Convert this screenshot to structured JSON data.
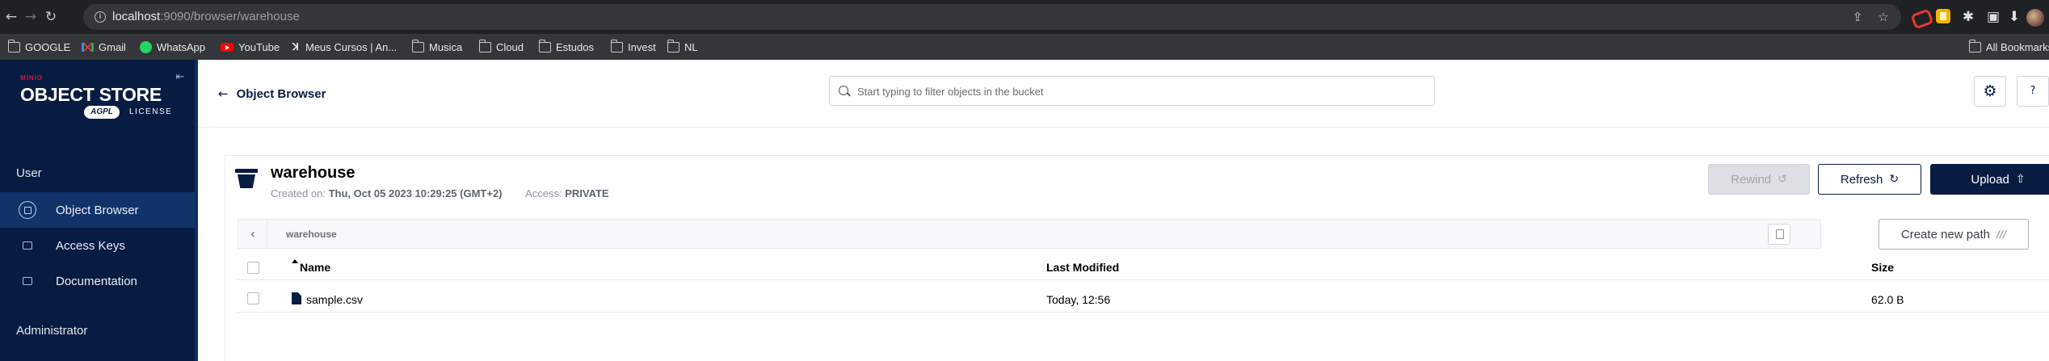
{
  "browser": {
    "url_host": "localhost",
    "url_rest": ":9090/browser/warehouse",
    "nav": {
      "back": "←",
      "forward": "→",
      "reload": "↻"
    },
    "bookmarks": [
      {
        "label": "GOOGLE",
        "icon": "folder-icon"
      },
      {
        "label": "Gmail",
        "icon": "gmail-icon"
      },
      {
        "label": "WhatsApp",
        "icon": "whatsapp-icon"
      },
      {
        "label": "YouTube",
        "icon": "youtube-icon"
      },
      {
        "label": "Meus Cursos | An...",
        "icon": "site-icon"
      },
      {
        "label": "Musica",
        "icon": "folder-icon"
      },
      {
        "label": "Cloud",
        "icon": "folder-icon"
      },
      {
        "label": "Estudos",
        "icon": "folder-icon"
      },
      {
        "label": "Invest",
        "icon": "folder-icon"
      },
      {
        "label": "NL",
        "icon": "folder-icon"
      }
    ],
    "all_bookmarks": "All Bookmarks"
  },
  "sidebar": {
    "logo_brand": "MINIO",
    "logo_title": "OBJECT STORE",
    "logo_badge": "AGPL",
    "logo_license": "LICENSE",
    "section_user": "User",
    "items": [
      {
        "label": "Object Browser",
        "active": true
      },
      {
        "label": "Access Keys",
        "active": false
      },
      {
        "label": "Documentation",
        "active": false
      }
    ],
    "section_admin": "Administrator"
  },
  "topbar": {
    "back_label": "Object Browser",
    "search_placeholder": "Start typing to filter objects in the bucket"
  },
  "bucket": {
    "name": "warehouse",
    "created_label": "Created on:",
    "created_value": "Thu, Oct 05 2023 10:29:25 (GMT+2)",
    "access_label": "Access:",
    "access_value": "PRIVATE",
    "buttons": {
      "rewind": "Rewind",
      "refresh": "Refresh",
      "upload": "Upload"
    },
    "path": "warehouse",
    "create_path": "Create new path"
  },
  "table": {
    "headers": {
      "name": "Name",
      "last_modified": "Last Modified",
      "size": "Size"
    },
    "rows": [
      {
        "name": "sample.csv",
        "last_modified": "Today, 12:56",
        "size": "62.0 B"
      }
    ]
  },
  "colors": {
    "brand_navy": "#081c42",
    "sidebar_active": "#103369",
    "minio_red": "#c51c3f"
  }
}
